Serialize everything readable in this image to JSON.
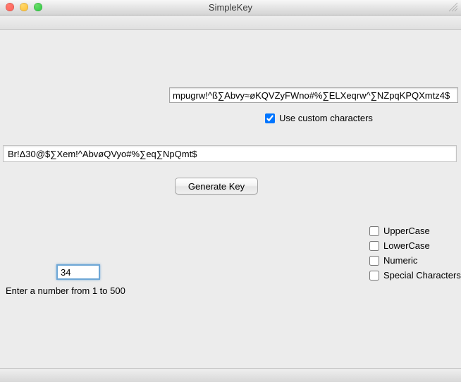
{
  "window": {
    "title": "SimpleKey"
  },
  "customChars": {
    "value": "mpugrw!^ß∑Abvy≈øKQVZyFWno#%∑ELXeqrw^∑NZpqKPQXmtz4$"
  },
  "useCustom": {
    "label": "Use custom characters",
    "checked": true
  },
  "output": {
    "value": "Br!Δ30@$∑Xem!^AbvøQVyo#%∑eq∑NpQmt$"
  },
  "generate": {
    "label": "Generate Key"
  },
  "options": {
    "upper": {
      "label": "UpperCase",
      "checked": false
    },
    "lower": {
      "label": "LowerCase",
      "checked": false
    },
    "numeric": {
      "label": "Numeric",
      "checked": false
    },
    "special": {
      "label": "Special Characters",
      "checked": false
    }
  },
  "length": {
    "value": "34",
    "helper": "Enter a number from 1 to 500"
  }
}
